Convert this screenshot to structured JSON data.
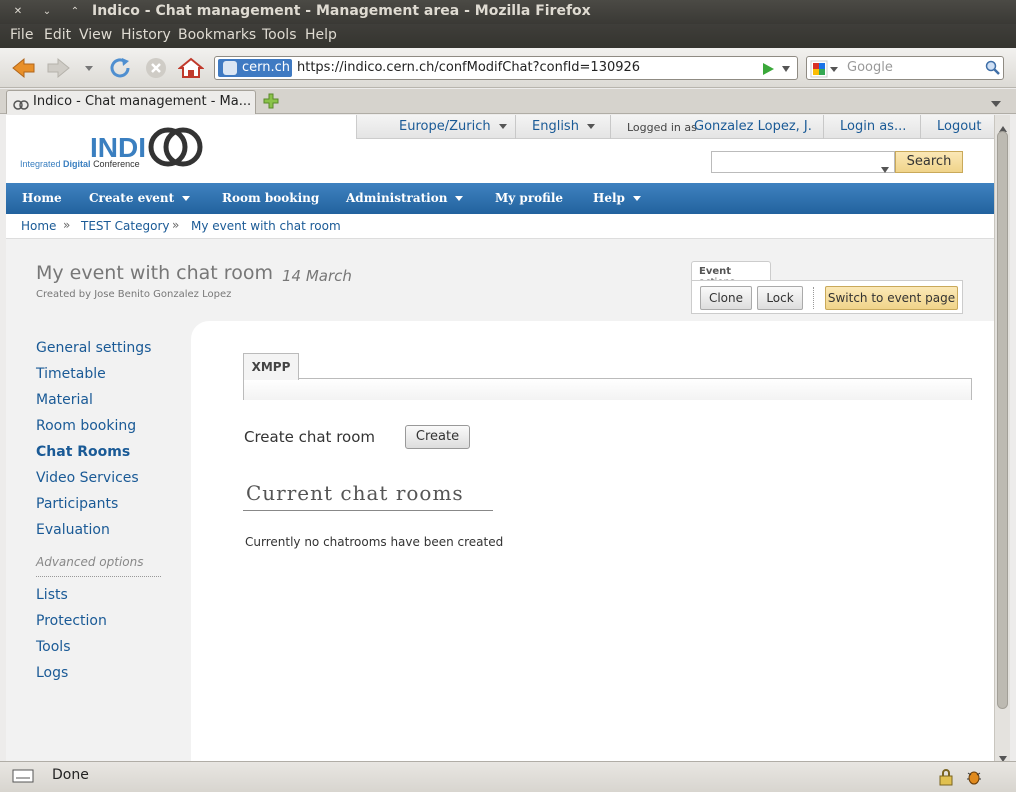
{
  "window": {
    "title": "Indico - Chat management - Management area - Mozilla Firefox"
  },
  "menubar": [
    "File",
    "Edit",
    "View",
    "History",
    "Bookmarks",
    "Tools",
    "Help"
  ],
  "toolbar": {
    "site_identity": "cern.ch",
    "url": "https://indico.cern.ch/confModifChat?confId=130926",
    "search_placeholder": "Google"
  },
  "tabs": [
    {
      "label": "Indico - Chat management - Ma...",
      "active": true
    }
  ],
  "indico": {
    "session": {
      "timezone": "Europe/Zurich",
      "language": "English",
      "logged_in_prefix": "Logged in as",
      "user": "Gonzalez Lopez, J.",
      "login_as": "Login as...",
      "logout": "Logout"
    },
    "search_button": "Search",
    "main_nav": [
      {
        "label": "Home",
        "dropdown": false
      },
      {
        "label": "Create event",
        "dropdown": true
      },
      {
        "label": "Room booking",
        "dropdown": false
      },
      {
        "label": "Administration",
        "dropdown": true
      },
      {
        "label": "My profile",
        "dropdown": false
      },
      {
        "label": "Help",
        "dropdown": true
      }
    ],
    "breadcrumb": [
      "Home",
      "TEST Category",
      "My event with chat room"
    ],
    "event": {
      "title": "My event with chat room",
      "date": "14 March",
      "creator": "Created by Jose Benito Gonzalez Lopez"
    },
    "event_actions": {
      "label_bold": "Event",
      "label_rest": "actions",
      "clone": "Clone",
      "lock": "Lock",
      "switch": "Switch to event page"
    },
    "side_menu": [
      {
        "label": "General settings"
      },
      {
        "label": "Timetable"
      },
      {
        "label": "Material"
      },
      {
        "label": "Room booking"
      },
      {
        "label": "Chat Rooms",
        "active": true
      },
      {
        "label": "Video Services"
      },
      {
        "label": "Participants"
      },
      {
        "label": "Evaluation"
      }
    ],
    "advanced_label": "Advanced options",
    "advanced_menu": [
      {
        "label": "Lists"
      },
      {
        "label": "Protection"
      },
      {
        "label": "Tools"
      },
      {
        "label": "Logs"
      }
    ],
    "panel": {
      "tab": "XMPP",
      "create_label": "Create chat room",
      "create_button": "Create",
      "rooms_title": "Current chat rooms",
      "no_rooms": "Currently no chatrooms have been created"
    }
  },
  "statusbar": {
    "text": "Done"
  },
  "colors": {
    "link": "#1a5a96",
    "nav_blue": "#2c6fad",
    "search_button": "#f0d48a"
  }
}
